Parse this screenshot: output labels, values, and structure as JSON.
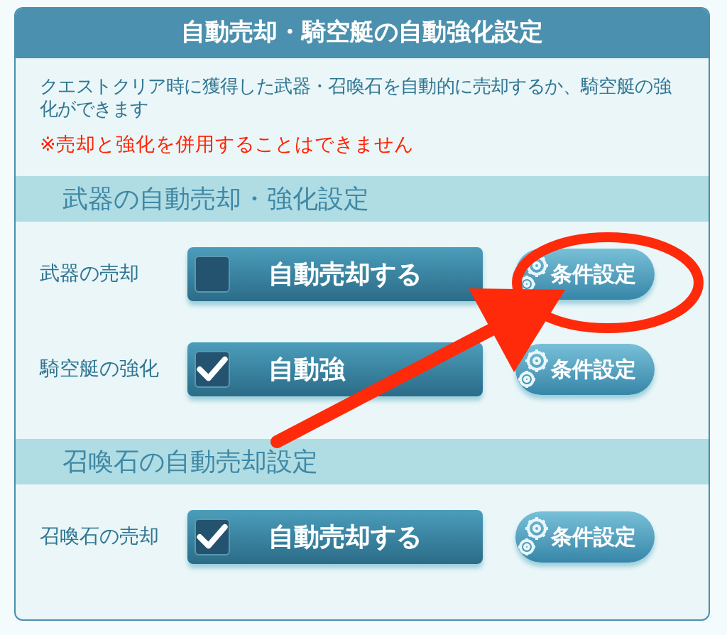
{
  "panel": {
    "title": "自動売却・騎空艇の自動強化設定",
    "description": "クエストクリア時に獲得した武器・召喚石を自動的に売却するか、騎空艇の強化ができます",
    "warning": "※売却と強化を併用することはできません"
  },
  "sections": [
    {
      "title": "武器の自動売却・強化設定",
      "rows": [
        {
          "label": "武器の売却",
          "toggle": {
            "label": "自動売却する",
            "checked": false
          },
          "settings_button": "条件設定"
        },
        {
          "label": "騎空艇の強化",
          "toggle": {
            "label": "自動強",
            "checked": true
          },
          "settings_button": "条件設定"
        }
      ]
    },
    {
      "title": "召喚石の自動売却設定",
      "rows": [
        {
          "label": "召喚石の売却",
          "toggle": {
            "label": "自動売却する",
            "checked": true
          },
          "settings_button": "条件設定"
        }
      ]
    }
  ]
}
